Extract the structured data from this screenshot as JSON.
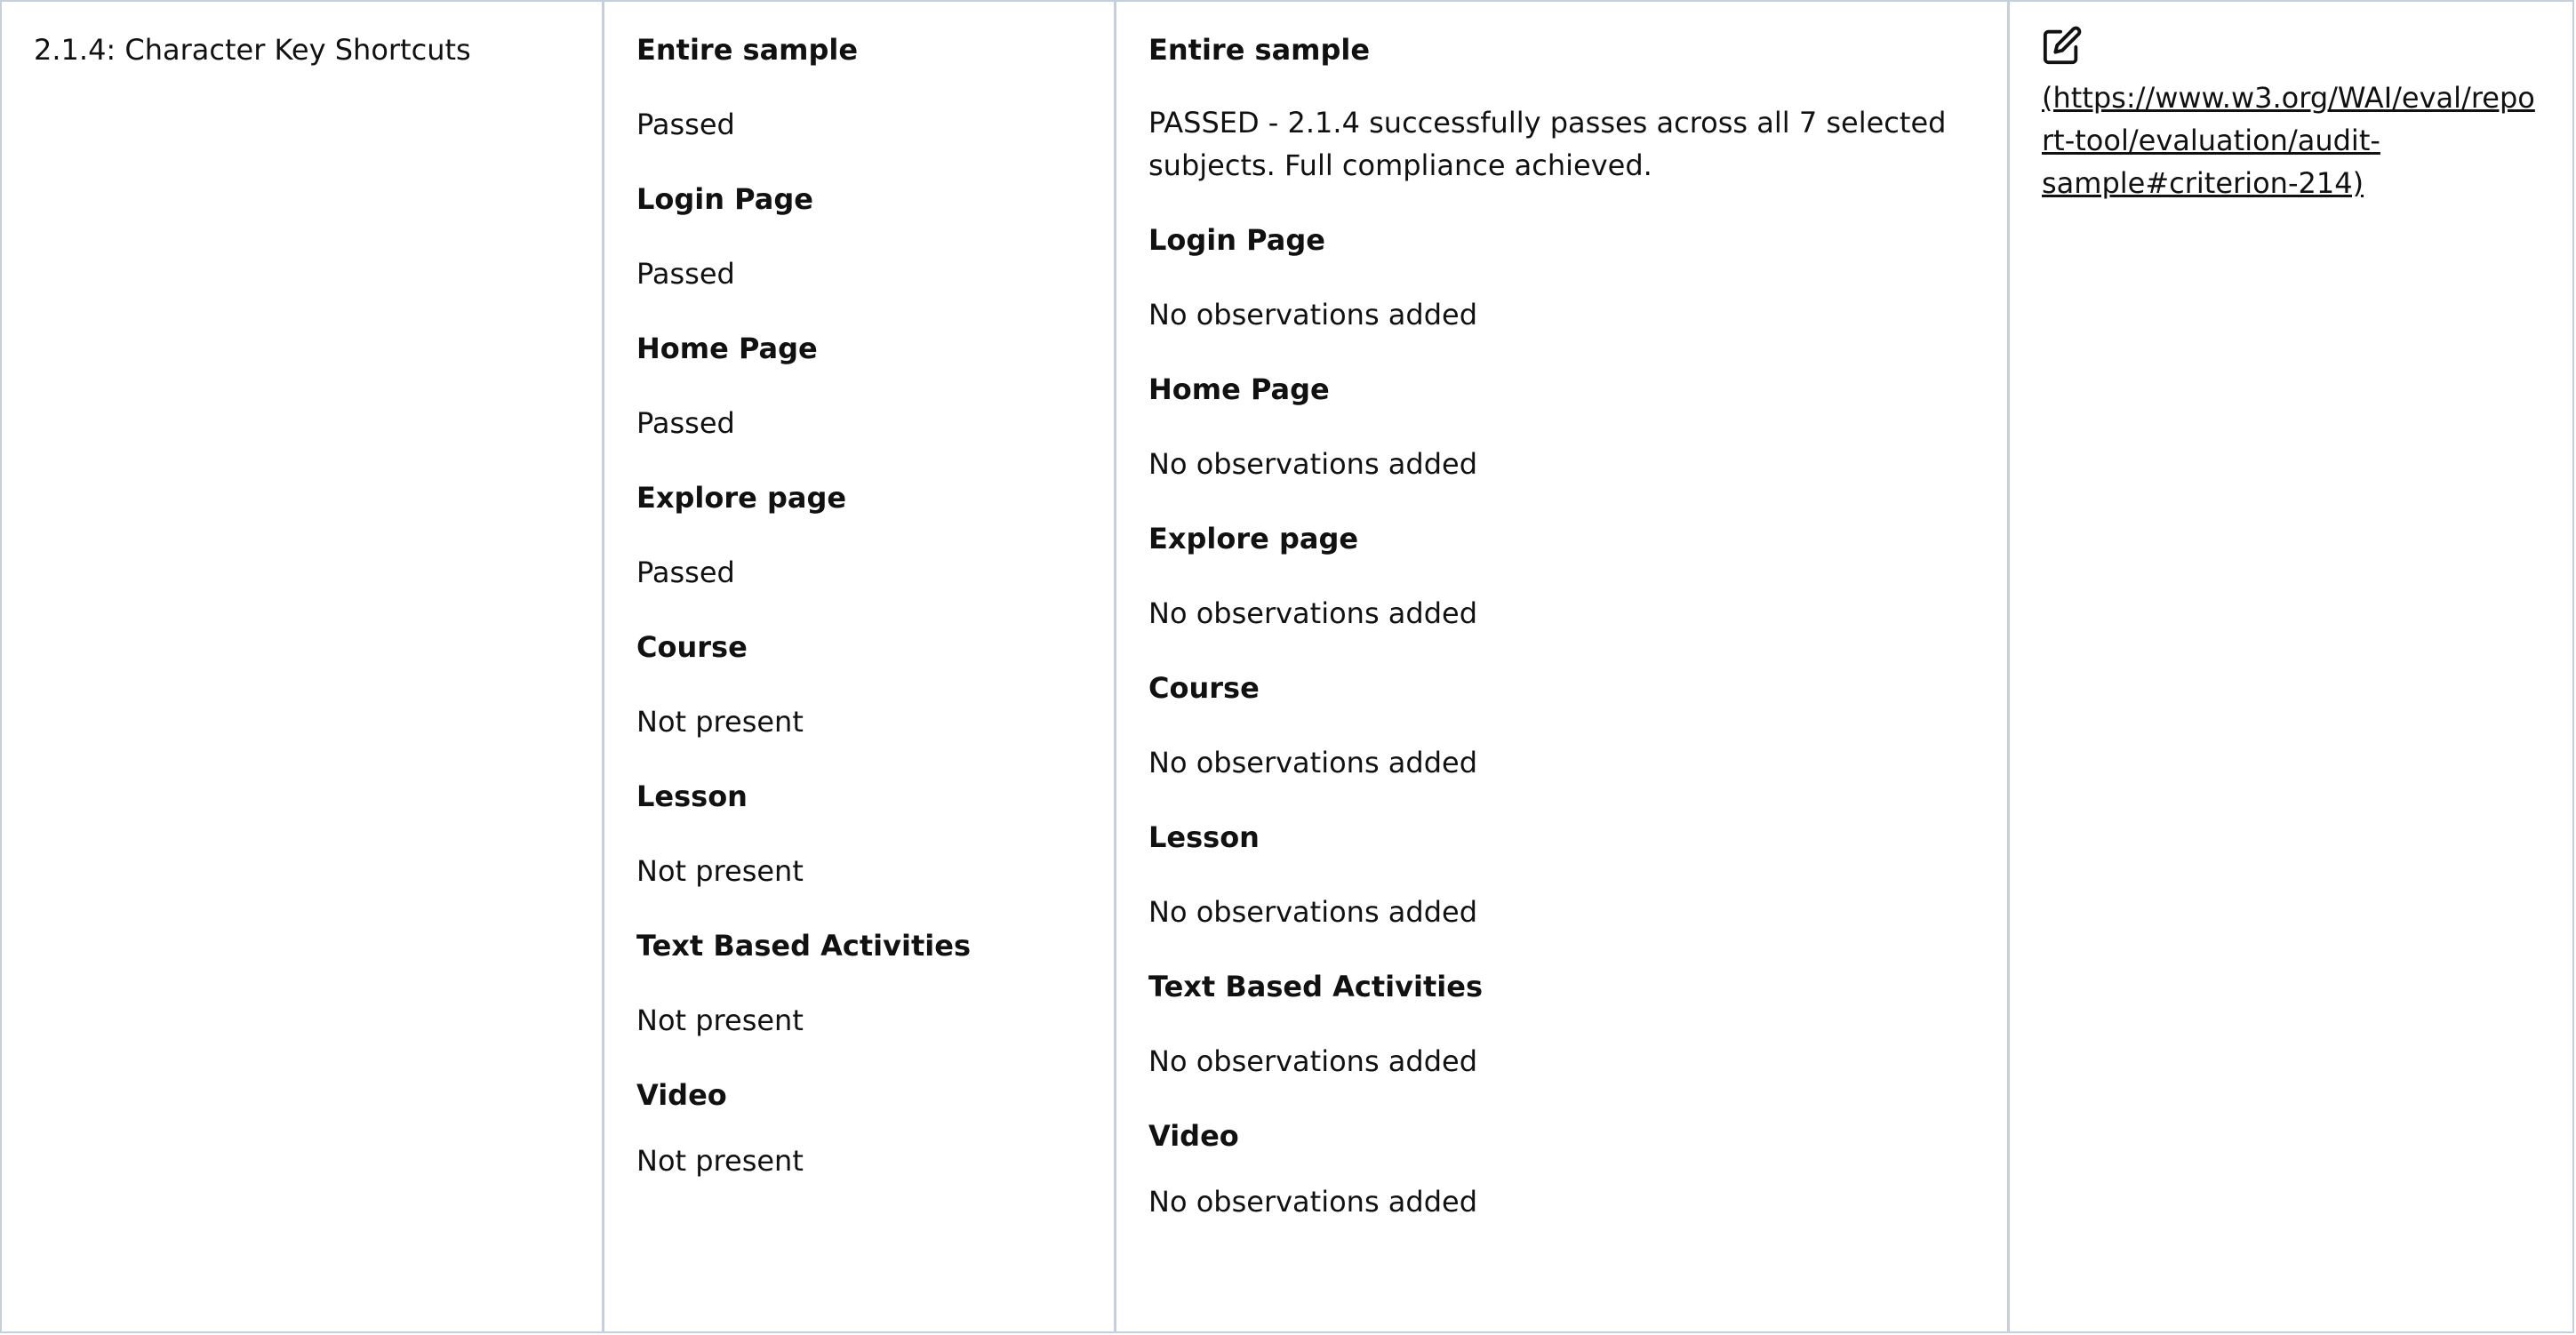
{
  "criterion": {
    "label": "2.1.4: Character Key Shortcuts"
  },
  "results": [
    {
      "subject": "Entire sample",
      "outcome": "Passed"
    },
    {
      "subject": "Login Page",
      "outcome": "Passed"
    },
    {
      "subject": "Home Page",
      "outcome": "Passed"
    },
    {
      "subject": "Explore page",
      "outcome": "Passed"
    },
    {
      "subject": "Course",
      "outcome": "Not present"
    },
    {
      "subject": "Lesson",
      "outcome": "Not present"
    },
    {
      "subject": "Text Based Activities",
      "outcome": "Not present"
    },
    {
      "subject": "Video",
      "outcome": "Not present"
    }
  ],
  "observations": [
    {
      "subject": "Entire sample",
      "text": "PASSED - 2.1.4 successfully passes across all 7 selected subjects. Full compliance achieved."
    },
    {
      "subject": "Login Page",
      "text": "No observations added"
    },
    {
      "subject": "Home Page",
      "text": "No observations added"
    },
    {
      "subject": "Explore page",
      "text": "No observations added"
    },
    {
      "subject": "Course",
      "text": "No observations added"
    },
    {
      "subject": "Lesson",
      "text": "No observations added"
    },
    {
      "subject": "Text Based Activities",
      "text": "No observations added"
    },
    {
      "subject": "Video",
      "text": "No observations added"
    }
  ],
  "edit": {
    "icon": "edit-icon",
    "link_text": "(https://www.w3.org/WAI/eval/report-tool/evaluation/audit-sample#criterion-214)"
  }
}
